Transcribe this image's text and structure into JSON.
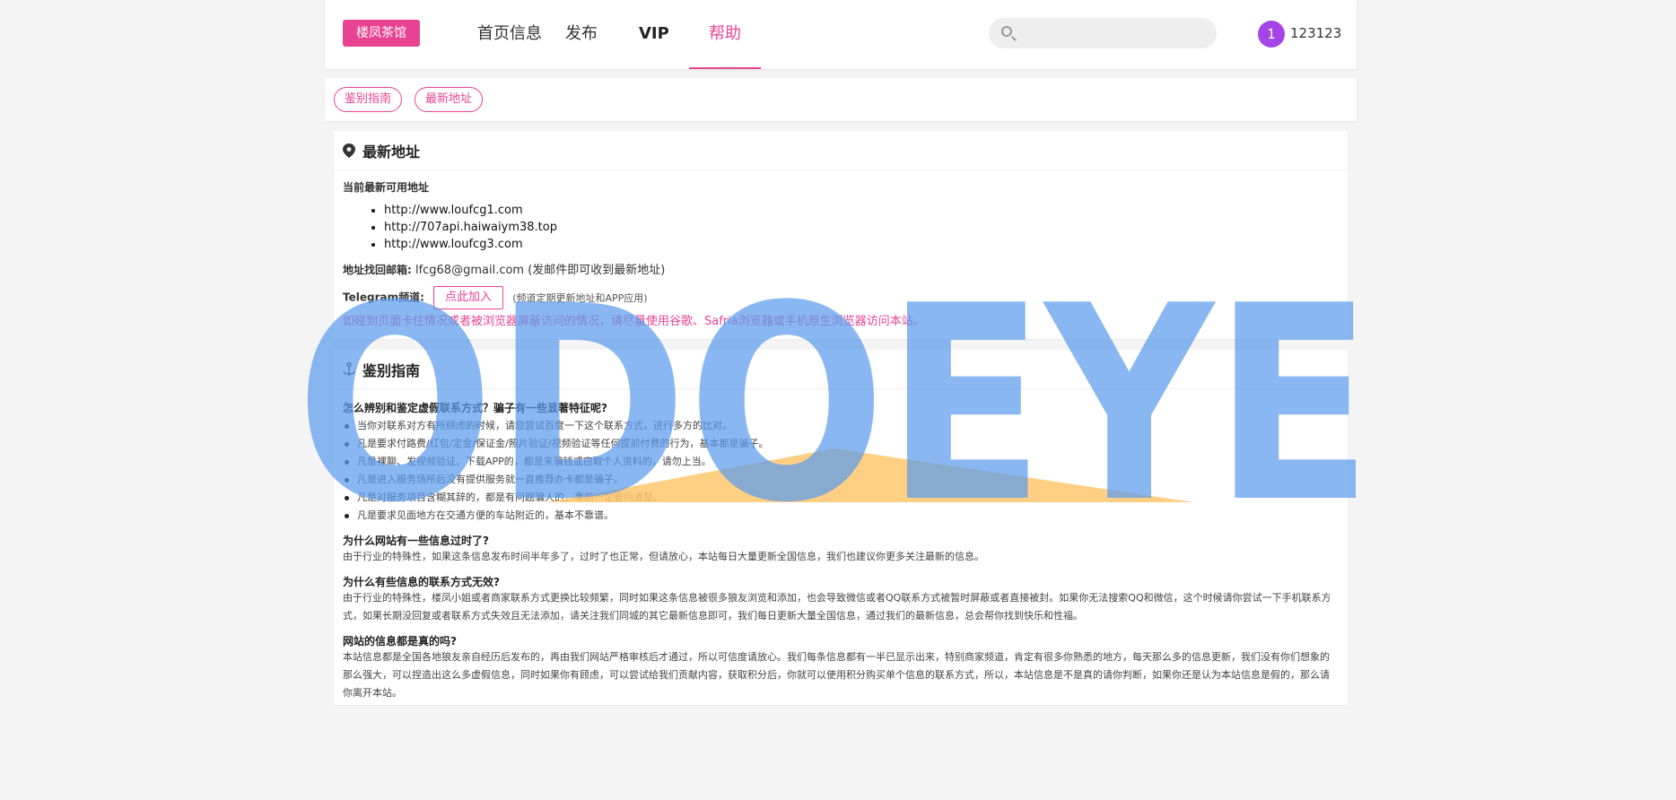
{
  "header": {
    "brand": "楼凤茶馆",
    "nav": [
      "首页信息",
      "发布",
      "VIP",
      "帮助"
    ],
    "search_placeholder": "",
    "avatar_badge": "1",
    "username": "123123"
  },
  "subnav": {
    "pills": [
      "鉴别指南",
      "最新地址"
    ]
  },
  "latest": {
    "title": "最新地址",
    "current_label": "当前最新可用地址",
    "urls": [
      "http://www.loufcg1.com",
      "http://707api.haiwaiym38.top",
      "http://www.loufcg3.com"
    ],
    "email_label": "地址找回邮箱:",
    "email": "lfcg68@gmail.com",
    "email_note": "(发邮件即可收到最新地址)",
    "telegram_label": "Telegram频道:",
    "telegram_button": "点此加入",
    "telegram_note": "(频道定期更新地址和APP应用)",
    "warning": "如碰到页面卡住情况或者被浏览器屏蔽访问的情况，请尽量使用谷歌、Safria浏览器或手机原生浏览器访问本站。"
  },
  "guide": {
    "title": "鉴别指南",
    "q1": "怎么辨别和鉴定虚假联系方式？骗子有一些显著特征呢?",
    "tips": [
      "当你对联系对方有所顾虑的时候，请您尝试百度一下这个联系方式，进行多方的比对。",
      "凡是要求付路费/红包/定金/保证金/照片验证/视频验证等任何提前付费的行为，基本都是骗子。",
      "凡是裸聊、发视频验证、下载APP的，都是来骗钱或窃取个人资料的，请勿上当。",
      "凡是进入服务场所后没有提供服务就一直推荐办卡都是骗子。",
      "凡是对服务项目含糊其辞的，都是有问题骗人的，事前一定要问清楚。",
      "凡是要求见面地方在交通方便的车站附近的，基本不靠谱。"
    ],
    "q2": "为什么网站有一些信息过时了?",
    "a2": "由于行业的特殊性，如果这条信息发布时间半年多了，过时了也正常，但请放心，本站每日大量更新全国信息，我们也建议你更多关注最新的信息。",
    "q3": "为什么有些信息的联系方式无效?",
    "a3": "由于行业的特殊性，楼凤小姐或者商家联系方式更换比较频繁，同时如果这条信息被很多狼友浏览和添加，也会导致微信或者QQ联系方式被暂时屏蔽或者直接被封。如果你无法搜索QQ和微信，这个时候请你尝试一下手机联系方式，如果长期没回复或者联系方式失效且无法添加，请关注我们同城的其它最新信息即可，我们每日更新大量全国信息，通过我们的最新信息，总会帮你找到快乐和性福。",
    "q4": "网站的信息都是真的吗?",
    "a4": "本站信息都是全国各地狼友亲自经历后发布的，再由我们网站严格审核后才通过，所以可信度请放心。我们每条信息都有一半已显示出来，特别商家频道，肯定有很多你熟悉的地方，每天那么多的信息更新，我们没有你们想象的那么强大，可以捏造出这么多虚假信息，同时如果你有顾虑，可以尝试给我们贡献内容，获取积分后，你就可以使用积分购买单个信息的联系方式，所以，本站信息是不是真的请你判断，如果你还是认为本站信息是假的，那么请你离开本站。"
  },
  "watermark": {
    "text": "ODOEYE",
    "color_blue": "#5b9bec",
    "color_orange": "#ffc76e"
  },
  "colors": {
    "accent": "#e84393",
    "avatar": "#a545e8"
  }
}
